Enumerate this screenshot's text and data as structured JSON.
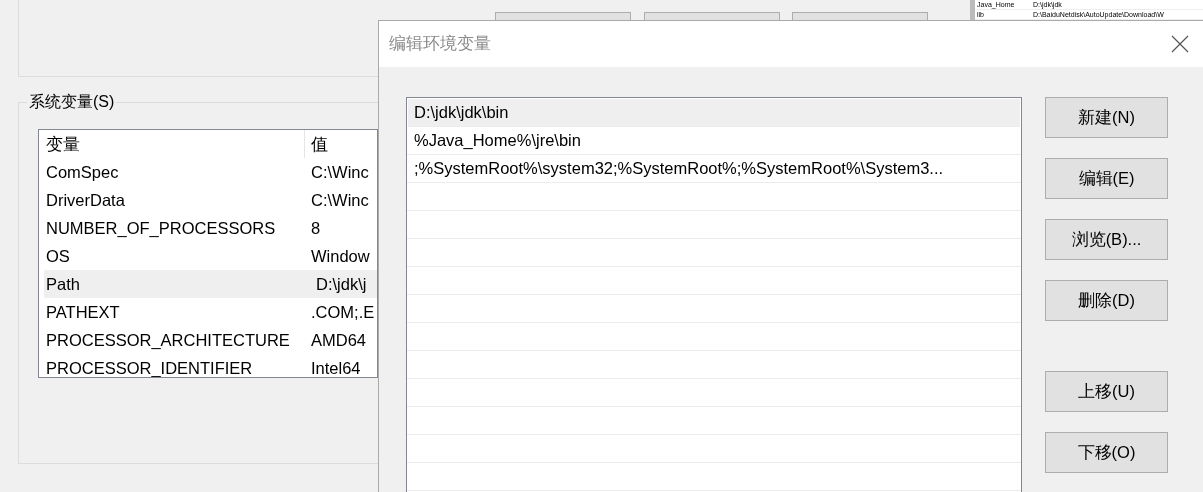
{
  "system_variables": {
    "title": "系统变量(S)",
    "columns": [
      "变量",
      "值"
    ],
    "rows": [
      {
        "name": "ComSpec",
        "value": "C:\\Winc",
        "selected": false
      },
      {
        "name": "DriverData",
        "value": "C:\\Winc",
        "selected": false
      },
      {
        "name": "NUMBER_OF_PROCESSORS",
        "value": "8",
        "selected": false
      },
      {
        "name": "OS",
        "value": "Window",
        "selected": false
      },
      {
        "name": "Path",
        "value": "D:\\jdk\\j",
        "selected": true
      },
      {
        "name": "PATHEXT",
        "value": ".COM;.E",
        "selected": false
      },
      {
        "name": "PROCESSOR_ARCHITECTURE",
        "value": "AMD64",
        "selected": false
      },
      {
        "name": "PROCESSOR_IDENTIFIER",
        "value": "Intel64",
        "selected": false
      }
    ]
  },
  "side_window": {
    "rows": [
      {
        "name": "Java_Home",
        "value": "D:\\jdk\\jdk"
      },
      {
        "name": "lib",
        "value": "D:\\BaiduNetdisk\\AutoUpdate\\Download\\W"
      }
    ]
  },
  "dialog": {
    "title": "编辑环境变量",
    "entries": [
      {
        "text": "D:\\jdk\\jdk\\bin",
        "selected": true
      },
      {
        "text": "%Java_Home%\\jre\\bin",
        "selected": false
      },
      {
        "text": ";%SystemRoot%\\system32;%SystemRoot%;%SystemRoot%\\System3...",
        "selected": false
      }
    ],
    "button_groups": [
      [
        "新建(N)",
        "编辑(E)",
        "浏览(B)...",
        "删除(D)"
      ],
      [
        "上移(U)",
        "下移(O)"
      ]
    ]
  }
}
